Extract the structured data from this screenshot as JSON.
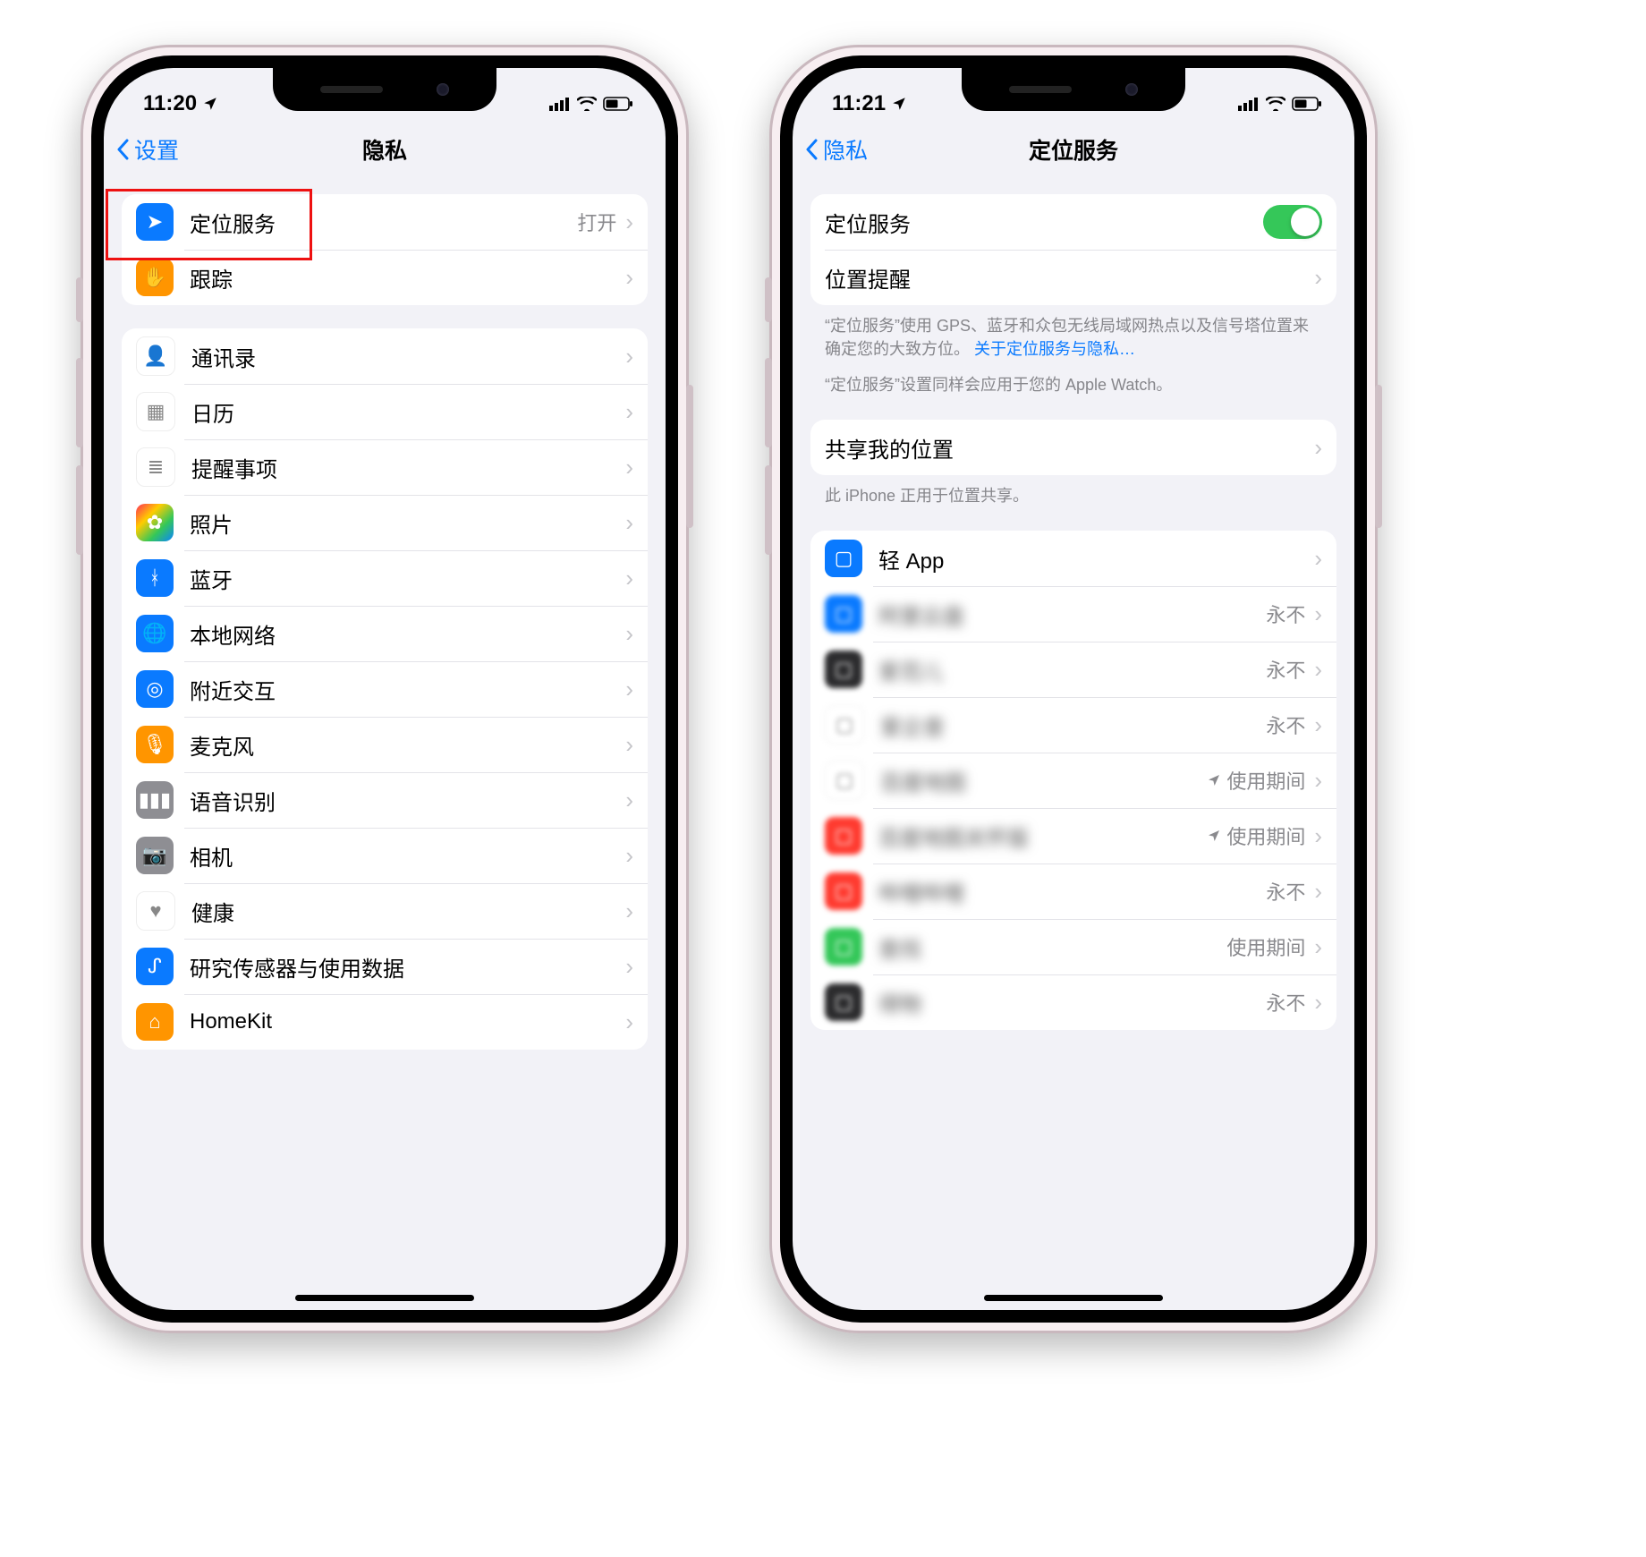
{
  "phones": {
    "left": {
      "status_time": "11:20",
      "back_label": "设置",
      "title": "隐私",
      "group1": [
        {
          "label": "定位服务",
          "value": "打开",
          "icon": "location-arrow-icon",
          "bg": "bg-blue"
        },
        {
          "label": "跟踪",
          "value": "",
          "icon": "hand-icon",
          "bg": "bg-orange"
        }
      ],
      "group2": [
        {
          "label": "通讯录",
          "icon": "contacts-icon",
          "bg": "bg-white"
        },
        {
          "label": "日历",
          "icon": "calendar-icon",
          "bg": "bg-white"
        },
        {
          "label": "提醒事项",
          "icon": "reminders-icon",
          "bg": "bg-white"
        },
        {
          "label": "照片",
          "icon": "photos-icon",
          "bg": "bg-grad"
        },
        {
          "label": "蓝牙",
          "icon": "bluetooth-icon",
          "bg": "bg-blue"
        },
        {
          "label": "本地网络",
          "icon": "globe-icon",
          "bg": "bg-blue"
        },
        {
          "label": "附近交互",
          "icon": "nearby-icon",
          "bg": "bg-blue"
        },
        {
          "label": "麦克风",
          "icon": "mic-icon",
          "bg": "bg-orange"
        },
        {
          "label": "语音识别",
          "icon": "speech-icon",
          "bg": "bg-gray"
        },
        {
          "label": "相机",
          "icon": "camera-icon",
          "bg": "bg-gray"
        },
        {
          "label": "健康",
          "icon": "health-icon",
          "bg": "bg-white"
        },
        {
          "label": "研究传感器与使用数据",
          "icon": "sensors-icon",
          "bg": "bg-blue"
        },
        {
          "label": "HomeKit",
          "icon": "home-icon",
          "bg": "bg-orange"
        }
      ]
    },
    "right": {
      "status_time": "11:21",
      "back_label": "隐私",
      "title": "定位服务",
      "row_toggle_label": "定位服务",
      "row_alerts_label": "位置提醒",
      "desc1_a": "“定位服务”使用 GPS、蓝牙和众包无线局域网热点以及信号塔位置来确定您的大致方位。",
      "desc1_link": "关于定位服务与隐私…",
      "desc2": "“定位服务”设置同样会应用于您的 Apple Watch。",
      "row_share_label": "共享我的位置",
      "desc_share": "此 iPhone 正用于位置共享。",
      "apps": [
        {
          "label": "轻 App",
          "value": "",
          "blurred": false,
          "bg": "bg-blue",
          "indicator": ""
        },
        {
          "label": "阿里云盘",
          "value": "永不",
          "blurred": true,
          "bg": "bg-blue",
          "indicator": ""
        },
        {
          "label": "爱范儿",
          "value": "永不",
          "blurred": true,
          "bg": "bg-dk",
          "indicator": ""
        },
        {
          "label": "爱企查",
          "value": "永不",
          "blurred": true,
          "bg": "bg-white",
          "indicator": ""
        },
        {
          "label": "百度地图",
          "value": "使用期间",
          "blurred": true,
          "bg": "bg-white",
          "indicator": "arrow"
        },
        {
          "label": "百度地图关怀版",
          "value": "使用期间",
          "blurred": true,
          "bg": "bg-red",
          "indicator": "arrow"
        },
        {
          "label": "哔哩哔哩",
          "value": "永不",
          "blurred": true,
          "bg": "bg-red",
          "indicator": ""
        },
        {
          "label": "查找",
          "value": "使用期间",
          "blurred": true,
          "bg": "bg-green",
          "indicator": ""
        },
        {
          "label": "得物",
          "value": "永不",
          "blurred": true,
          "bg": "bg-dk",
          "indicator": ""
        }
      ]
    }
  },
  "icon_glyphs": {
    "location-arrow-icon": "➤",
    "hand-icon": "✋",
    "contacts-icon": "👤",
    "calendar-icon": "▦",
    "reminders-icon": "≣",
    "photos-icon": "✿",
    "bluetooth-icon": "ᚼ",
    "globe-icon": "🌐",
    "nearby-icon": "◎",
    "mic-icon": "🎙",
    "speech-icon": "▮▮▮",
    "camera-icon": "📷",
    "health-icon": "♥",
    "sensors-icon": "ᔑ",
    "home-icon": "⌂"
  }
}
